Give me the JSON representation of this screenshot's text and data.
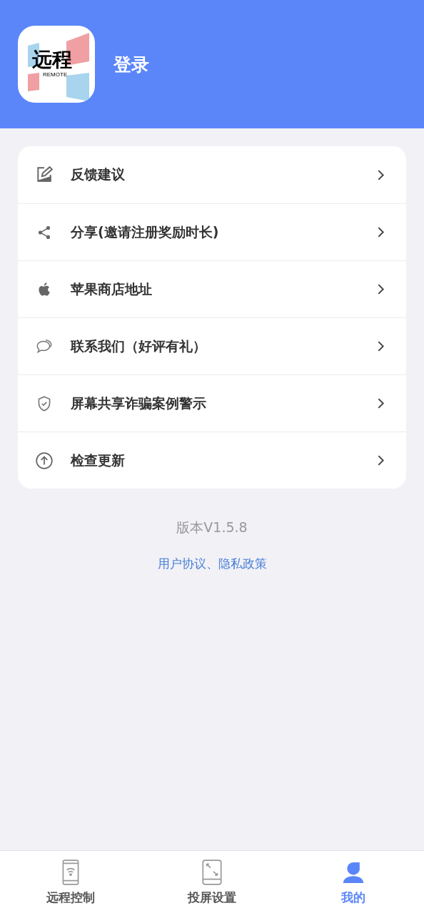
{
  "header": {
    "logo": {
      "title": "远程",
      "subtitle": "REMOTE"
    },
    "login": "登录"
  },
  "menu": [
    {
      "label": "反馈建议"
    },
    {
      "label": "分享(邀请注册奖励时长)"
    },
    {
      "label": "苹果商店地址"
    },
    {
      "label": "联系我们（好评有礼）"
    },
    {
      "label": "屏幕共享诈骗案例警示"
    },
    {
      "label": "检查更新"
    }
  ],
  "version": "版本V1.5.8",
  "legal_link": "用户协议、隐私政策",
  "tabs": [
    {
      "label": "远程控制",
      "selected": false
    },
    {
      "label": "投屏设置",
      "selected": false
    },
    {
      "label": "我的",
      "selected": true
    }
  ]
}
